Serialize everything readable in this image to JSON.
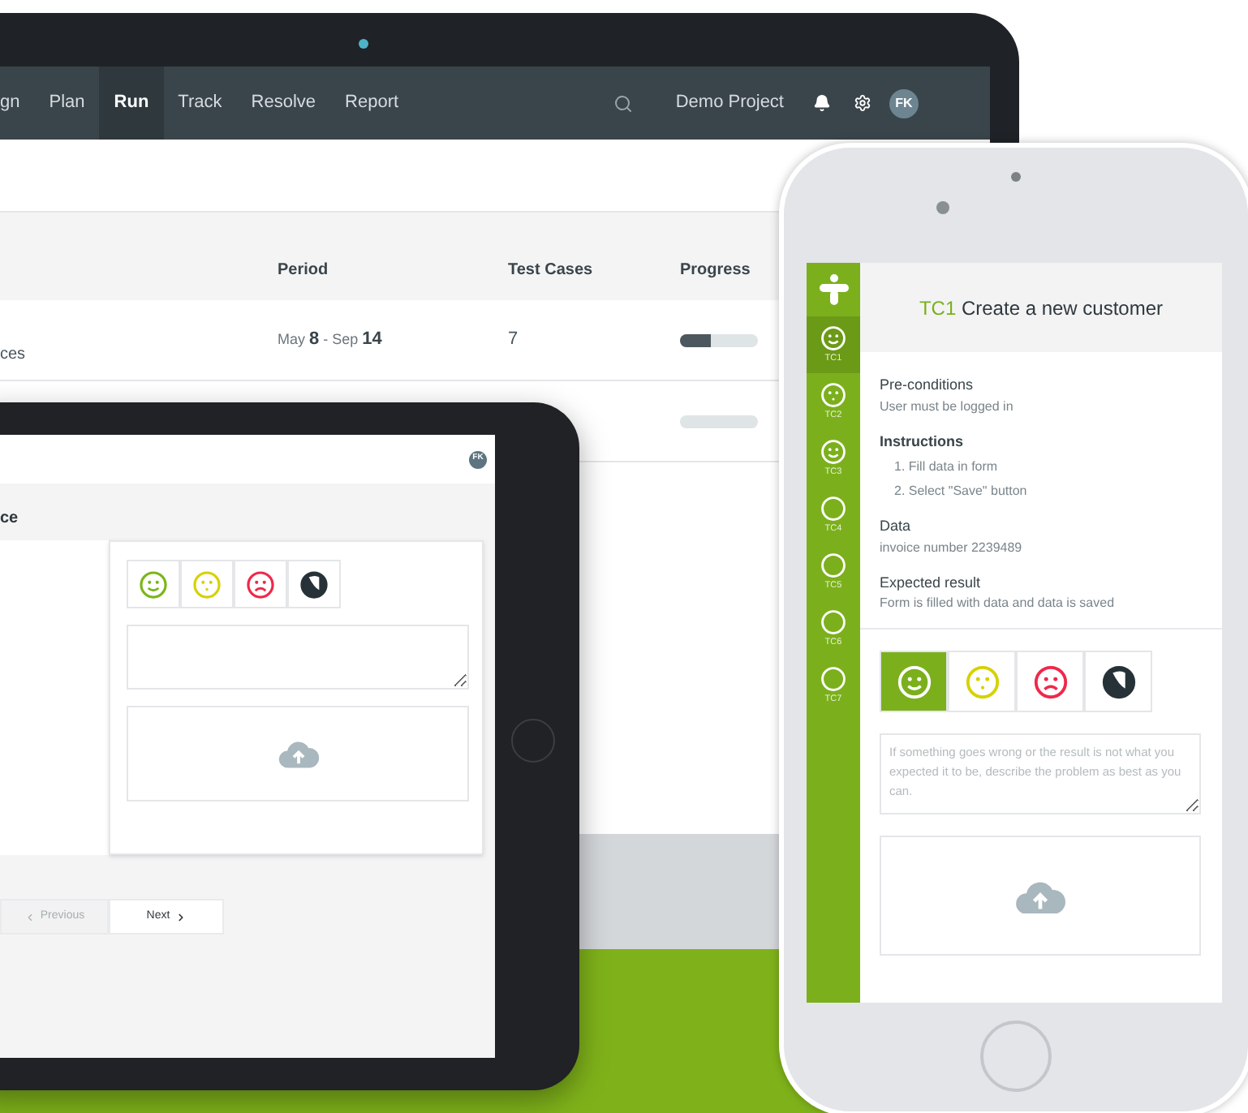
{
  "laptop": {
    "nav": {
      "items": [
        {
          "label": "gn",
          "selected": false
        },
        {
          "label": "Plan",
          "selected": false
        },
        {
          "label": "Run",
          "selected": true
        },
        {
          "label": "Track",
          "selected": false
        },
        {
          "label": "Resolve",
          "selected": false
        },
        {
          "label": "Report",
          "selected": false
        }
      ],
      "project": "Demo Project",
      "avatar": "FK"
    },
    "table": {
      "columns": [
        "Period",
        "Test Cases",
        "Progress"
      ],
      "rows": [
        {
          "name": "ces",
          "period": "May **8** - Sep **14**",
          "test_cases": "7",
          "level": 0.4
        },
        {
          "level": 0
        }
      ]
    }
  },
  "tablet": {
    "avatar": "FK",
    "heading": "ce",
    "results": [
      {
        "kind": "passed",
        "selected": false
      },
      {
        "kind": "warning",
        "selected": false
      },
      {
        "kind": "failed",
        "selected": false
      },
      {
        "kind": "blocked",
        "selected": false
      }
    ],
    "pager": [
      {
        "kind": "prev",
        "label": "Previous",
        "disabled": true
      },
      {
        "kind": "next",
        "label": "Next",
        "disabled": false
      }
    ]
  },
  "phone": {
    "sidebar": [
      {
        "label": "TC1",
        "kind": "passed",
        "selected": true
      },
      {
        "label": "TC2",
        "kind": "warning",
        "selected": false
      },
      {
        "label": "TC3",
        "kind": "passed",
        "selected": false
      },
      {
        "label": "TC4",
        "kind": "none",
        "selected": false
      },
      {
        "label": "TC5",
        "kind": "none",
        "selected": false
      },
      {
        "label": "TC6",
        "kind": "none",
        "selected": false
      },
      {
        "label": "TC7",
        "kind": "none",
        "selected": false
      }
    ],
    "title_id": "TC1",
    "title": "Create a new customer",
    "sections": [
      {
        "kind": "text",
        "heading": "Pre-conditions",
        "text": "User must be logged in"
      },
      {
        "kind": "steps",
        "heading": "Instructions",
        "steps": [
          "1. Fill data in form",
          "2. Select \"Save\" button"
        ]
      },
      {
        "kind": "text",
        "heading": "Data",
        "text": "invoice number 2239489"
      },
      {
        "kind": "text",
        "heading": "Expected result",
        "text": "Form is filled with data and data is saved"
      }
    ],
    "results": [
      {
        "kind": "passed",
        "selected": true
      },
      {
        "kind": "warning",
        "selected": false
      },
      {
        "kind": "failed",
        "selected": false
      },
      {
        "kind": "blocked",
        "selected": false
      }
    ],
    "comment_placeholder": "If something goes wrong or the result is not what you expected it to be, describe the problem as best as you can."
  }
}
